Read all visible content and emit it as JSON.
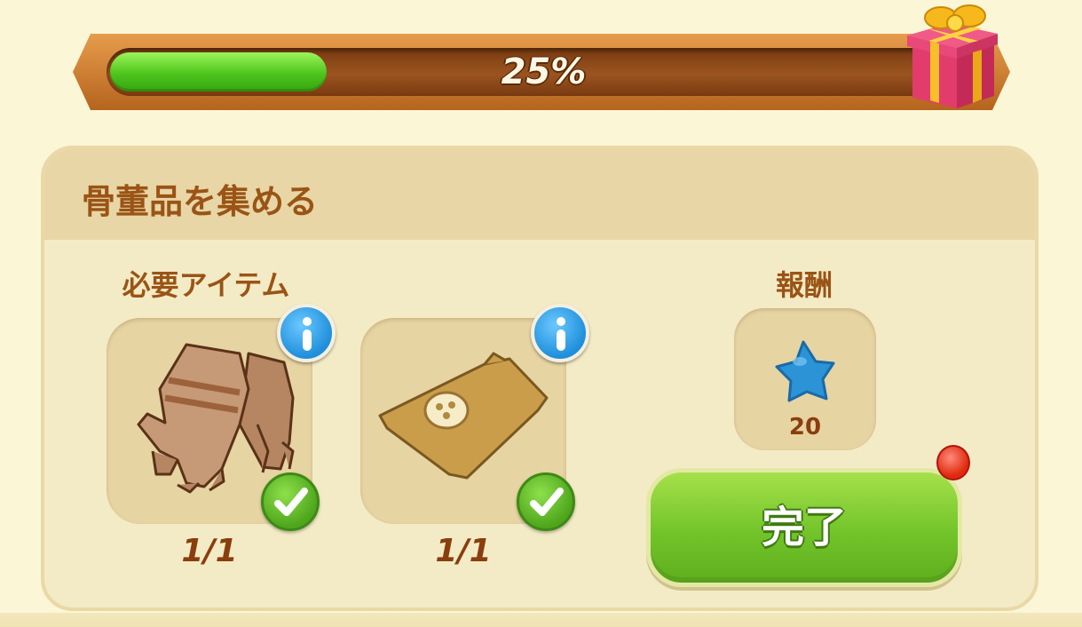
{
  "progress": {
    "percent": 25,
    "label": "25%"
  },
  "quest": {
    "title": "骨董品を集める",
    "required_label": "必要アイテム",
    "reward_label": "報酬",
    "items": [
      {
        "icon": "leather-gloves-icon",
        "count": "1/1",
        "complete": true
      },
      {
        "icon": "cloth-bag-icon",
        "count": "1/1",
        "complete": true
      }
    ],
    "reward": {
      "icon": "blue-star-icon",
      "amount": "20"
    },
    "complete_button_label": "完了"
  },
  "colors": {
    "background": "#fbf6d6",
    "title_brown": "#9a5416",
    "progress_green": "#4ec41c",
    "button_green": "#72c42a",
    "info_blue": "#1f8fdb",
    "notify_red": "#e02a10"
  }
}
